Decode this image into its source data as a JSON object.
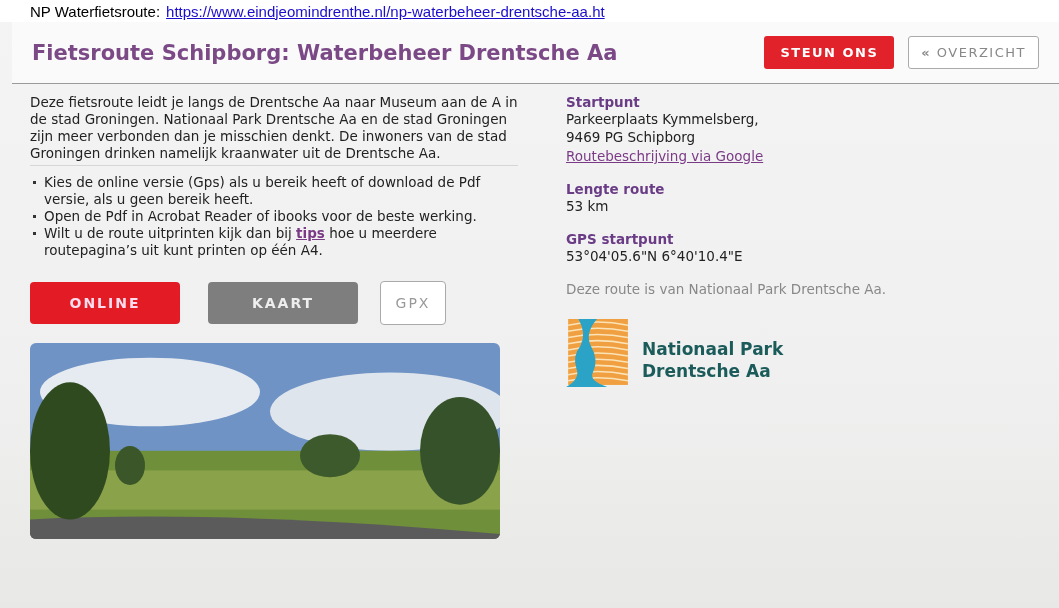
{
  "source_line": {
    "label": "NP Waterfietsroute:",
    "link": "https://www.eindjeomindrenthe.nl/np-waterbeheer-drentsche-aa.ht"
  },
  "header": {
    "title": "Fietsroute Schipborg: Waterbeheer Drentsche Aa",
    "support_button": "STEUN ONS",
    "back_button": {
      "icon": "«",
      "label": "OVERZICHT"
    }
  },
  "intro": "Deze fietsroute leidt je langs de Drentsche Aa naar Museum aan de A in de stad Groningen. Nationaal Park Drentsche Aa en de stad Groningen zijn meer verbonden dan je misschien denkt. De inwoners van de stad Groningen drinken namelijk kraanwater uit de Drentsche Aa.",
  "tips": [
    {
      "text": "Kies de online versie (Gps) als u bereik heeft of download de Pdf versie, als u geen bereik heeft."
    },
    {
      "text": "Open de Pdf in Acrobat Reader of ibooks voor de beste werking."
    },
    {
      "text": "Wilt u de route uitprinten kijk dan bij",
      "link": "tips",
      "after": "hoe u meerdere routepagina’s uit kunt printen op één A4."
    }
  ],
  "actions": [
    {
      "label": "ONLINE",
      "kind": "primary"
    },
    {
      "label": "KAART",
      "kind": "secondary"
    },
    {
      "label": "GPX",
      "kind": "outline"
    }
  ],
  "details": [
    {
      "label": "Startpunt",
      "lines": [
        "Parkeerplaats Kymmelsberg,",
        "9469 PG Schipborg"
      ],
      "link": "Routebeschrijving via Google"
    },
    {
      "label": "Lengte route",
      "lines": [
        "53 km"
      ]
    },
    {
      "label": "GPS startpunt",
      "lines": [
        "53°04'05.6\"N 6°40'10.4\"E"
      ]
    }
  ],
  "owner_note": "Deze route is van Nationaal Park Drentsche Aa.",
  "logo": {
    "lines": [
      "Nationaal Park",
      "Drentsche Aa"
    ]
  }
}
